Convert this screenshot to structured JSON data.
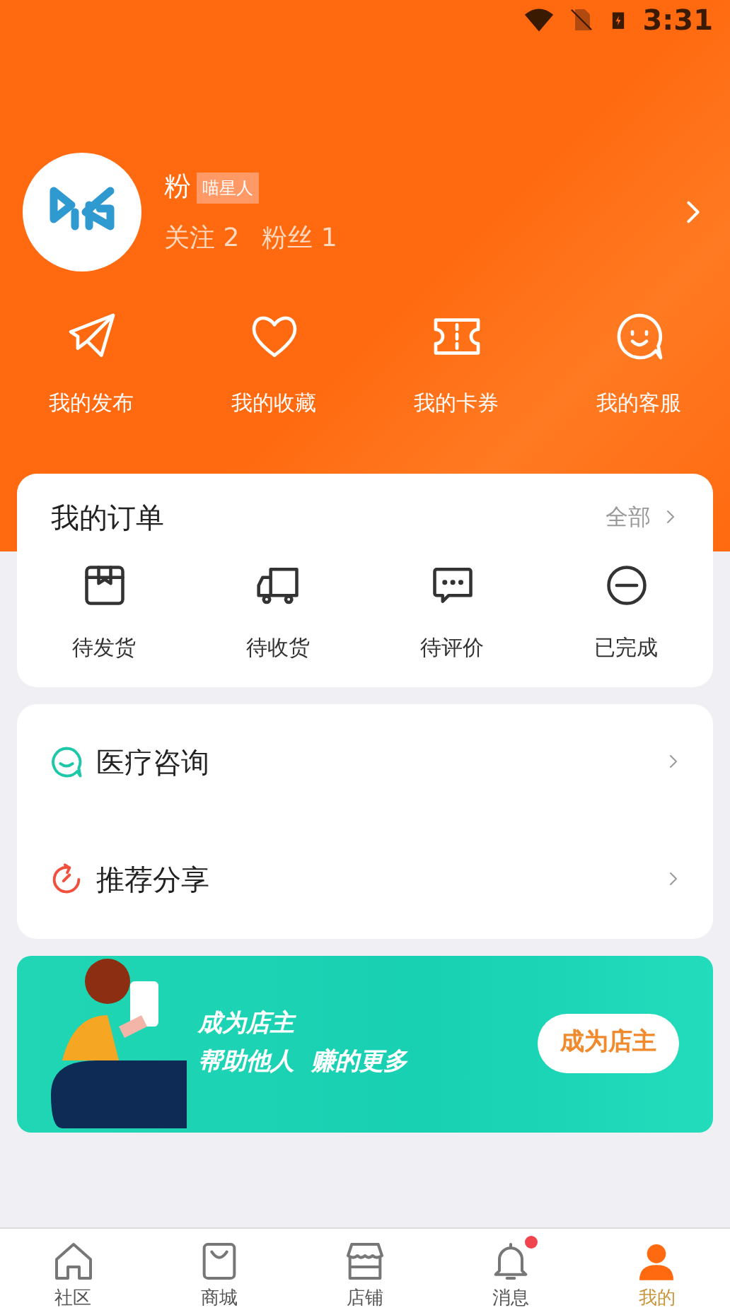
{
  "status_bar": {
    "time": "3:31"
  },
  "profile": {
    "name": "粉",
    "badge": "喵星人",
    "stats": [
      "关注 2",
      "粉丝 1"
    ]
  },
  "shortcuts": [
    {
      "kind": "plane",
      "label": "我的发布"
    },
    {
      "kind": "heart",
      "label": "我的收藏"
    },
    {
      "kind": "ticket",
      "label": "我的卡券"
    },
    {
      "kind": "smile",
      "label": "我的客服"
    }
  ],
  "orders": {
    "title": "我的订单",
    "all": "全部",
    "items": [
      {
        "kind": "box",
        "label": "待发货"
      },
      {
        "kind": "truck",
        "label": "待收货"
      },
      {
        "kind": "chat",
        "label": "待评价"
      },
      {
        "kind": "done",
        "label": "已完成"
      }
    ]
  },
  "menu": [
    {
      "kind": "consult",
      "label": "医疗咨询"
    },
    {
      "kind": "share",
      "label": "推荐分享"
    }
  ],
  "banner": {
    "lines": [
      "成为店主",
      "帮助他人  赚的更多"
    ],
    "button": "成为店主"
  },
  "tabs": [
    {
      "kind": "home",
      "label": "社区",
      "selected": false,
      "dot": false
    },
    {
      "kind": "bag",
      "label": "商城",
      "selected": false,
      "dot": false
    },
    {
      "kind": "shop",
      "label": "店铺",
      "selected": false,
      "dot": false
    },
    {
      "kind": "bell",
      "label": "消息",
      "selected": false,
      "dot": true
    },
    {
      "kind": "person",
      "label": "我的",
      "selected": true,
      "dot": false
    }
  ]
}
